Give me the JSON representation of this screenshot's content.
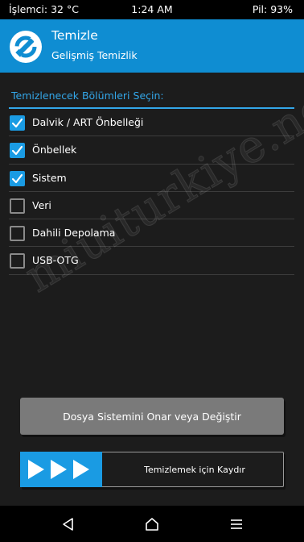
{
  "status_bar": {
    "temperature": "İşlemci: 32 °C",
    "time": "1:24 AM",
    "battery": "Pil: 93%"
  },
  "header": {
    "title": "Temizle",
    "subtitle": "Gelişmiş Temizlik",
    "logo_icon": "twrp-logo-icon"
  },
  "section_label": "Temizlenecek Bölümleri Seçin:",
  "options": [
    {
      "label": "Dalvik / ART Önbelleği",
      "checked": true
    },
    {
      "label": "Önbellek",
      "checked": true
    },
    {
      "label": "Sistem",
      "checked": true
    },
    {
      "label": "Veri",
      "checked": false
    },
    {
      "label": "Dahili Depolama",
      "checked": false
    },
    {
      "label": "USB-OTG",
      "checked": false
    }
  ],
  "repair_button": "Dosya Sistemini Onar veya Değiştir",
  "swipe": {
    "label": "Temizlemek için Kaydır",
    "icon": "triple-arrow-right-icon"
  },
  "watermark": "miuiturkiye.net",
  "nav_bar": {
    "back_icon": "back-triangle-icon",
    "home_icon": "home-icon",
    "menu_icon": "menu-lines-icon"
  },
  "colors": {
    "accent": "#0f8dd2",
    "checkbox_on": "#1a9be3",
    "background": "#1c1c1c",
    "button": "#7a7a7a"
  }
}
